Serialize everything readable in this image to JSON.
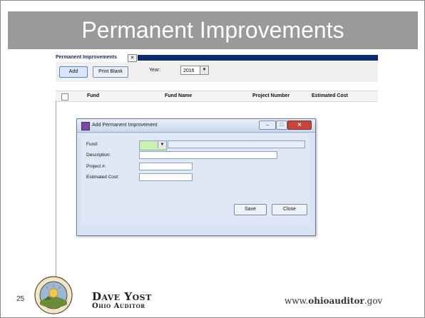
{
  "slide": {
    "title": "Permanent Improvements",
    "number": "25"
  },
  "app": {
    "tab": {
      "label": "Permanent Improvements",
      "close_glyph": "✕"
    },
    "toolbar": {
      "add_label": "Add",
      "print_blank_label": "Print Blank",
      "year_label": "Year:",
      "year_value": "2016"
    },
    "grid": {
      "columns": [
        "Fund",
        "Fund Name",
        "Project Number",
        "Estimated Cost"
      ]
    }
  },
  "dialog": {
    "title": "Add Permanent Improvement",
    "fields": {
      "fund_label": "Fund:",
      "description_label": "Description:",
      "project_label": "Project #:",
      "cost_label": "Estimated Cost:"
    },
    "save_label": "Save",
    "close_label": "Close"
  },
  "footer": {
    "auditor_name": "Dave Yost",
    "auditor_office": "Ohio Auditor",
    "website_prefix": "www.",
    "website_bold": "ohioauditor",
    "website_suffix": ".gov",
    "seal_text": "THE AUDITOR OF STATE OF OHIO"
  },
  "colors": {
    "title_bar": "#9a9a9a",
    "tab_fill": "#0a2a74",
    "dialog_bg": "#d8e4f4",
    "fund_select": "#c9f2b0",
    "close_button": "#c7463a"
  }
}
